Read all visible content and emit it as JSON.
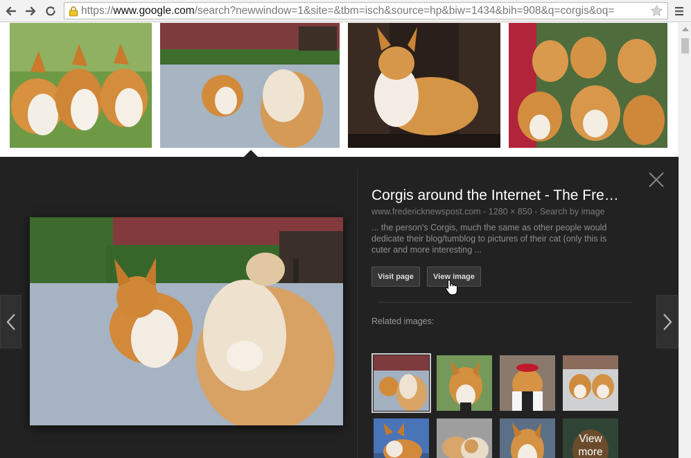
{
  "browser": {
    "url_scheme": "https://",
    "url_host": "www.google.com",
    "url_path": "/search?newwindow=1&site=&tbm=isch&source=hp&biw=1434&bih=908&q=corgis&oq="
  },
  "panel": {
    "title": "Corgis around the Internet - The Fre…",
    "meta": "www.fredericknewspost.com - 1280 × 850 - Search by image",
    "description": "... the person's Corgis, much the same as other people would dedicate their blog/tumblog to pictures of their cat (only this is cuter and more interesting ...",
    "visit_page_label": "Visit page",
    "view_image_label": "View image",
    "related_label": "Related images:",
    "view_more_line1": "View",
    "view_more_line2": "more"
  },
  "colors": {
    "panel_bg": "#222222",
    "toolbar_bg": "#f2f2f2"
  },
  "icons": [
    "back-icon",
    "forward-icon",
    "reload-icon",
    "lock-icon",
    "star-icon",
    "menu-icon",
    "close-icon",
    "chevron-left-icon",
    "chevron-right-icon",
    "hand-cursor-icon"
  ]
}
